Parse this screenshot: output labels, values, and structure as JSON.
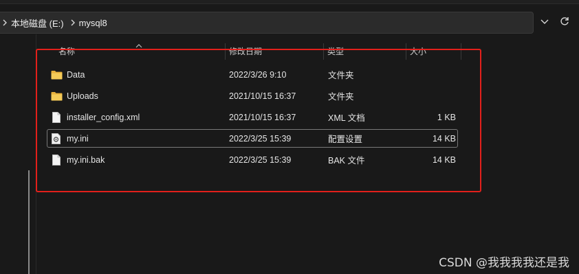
{
  "breadcrumb": {
    "items": [
      "本地磁盘 (E:)",
      "mysql8"
    ]
  },
  "columns": {
    "name": "名称",
    "date": "修改日期",
    "type": "类型",
    "size": "大小"
  },
  "files": [
    {
      "name": "Data",
      "date": "2022/3/26 9:10",
      "type": "文件夹",
      "size": "",
      "icon": "folder-icon"
    },
    {
      "name": "Uploads",
      "date": "2021/10/15 16:37",
      "type": "文件夹",
      "size": "",
      "icon": "folder-icon"
    },
    {
      "name": "installer_config.xml",
      "date": "2021/10/15 16:37",
      "type": "XML 文档",
      "size": "1 KB",
      "icon": "file-icon"
    },
    {
      "name": "my.ini",
      "date": "2022/3/25 15:39",
      "type": "配置设置",
      "size": "14 KB",
      "icon": "settings-file-icon"
    },
    {
      "name": "my.ini.bak",
      "date": "2022/3/25 15:39",
      "type": "BAK 文件",
      "size": "14 KB",
      "icon": "file-icon"
    }
  ],
  "selected_row": 3,
  "watermark": "CSDN @我我我我还是我",
  "colors": {
    "highlight_box": "#e3201b",
    "folder": "#f3c24f",
    "background": "#191919"
  }
}
